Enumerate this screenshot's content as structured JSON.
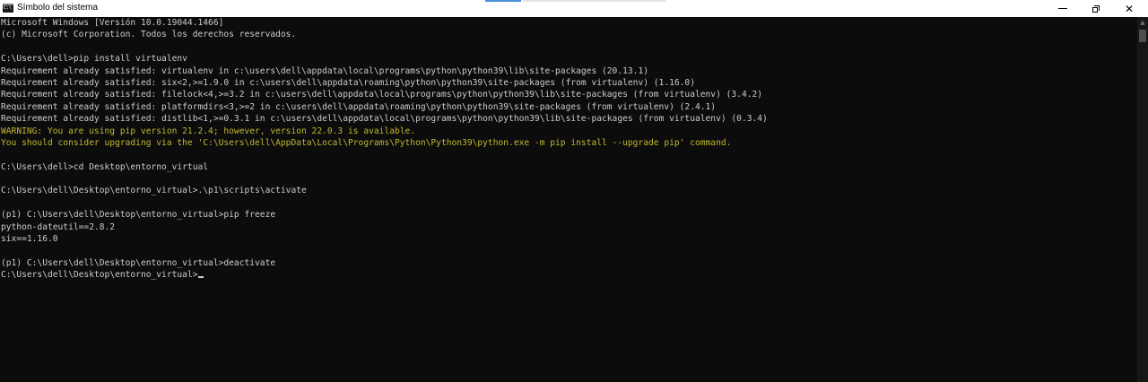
{
  "window": {
    "title": "Símbolo del sistema",
    "minimize_glyph": "",
    "close_glyph": "✕"
  },
  "console": {
    "lines": [
      {
        "text": "Microsoft Windows [Versión 10.0.19044.1466]",
        "style": "normal"
      },
      {
        "text": "(c) Microsoft Corporation. Todos los derechos reservados.",
        "style": "normal"
      },
      {
        "text": "",
        "style": "normal"
      },
      {
        "text": "C:\\Users\\dell>pip install virtualenv",
        "style": "normal"
      },
      {
        "text": "Requirement already satisfied: virtualenv in c:\\users\\dell\\appdata\\local\\programs\\python\\python39\\lib\\site-packages (20.13.1)",
        "style": "normal"
      },
      {
        "text": "Requirement already satisfied: six<2,>=1.9.0 in c:\\users\\dell\\appdata\\roaming\\python\\python39\\site-packages (from virtualenv) (1.16.0)",
        "style": "normal"
      },
      {
        "text": "Requirement already satisfied: filelock<4,>=3.2 in c:\\users\\dell\\appdata\\local\\programs\\python\\python39\\lib\\site-packages (from virtualenv) (3.4.2)",
        "style": "normal"
      },
      {
        "text": "Requirement already satisfied: platformdirs<3,>=2 in c:\\users\\dell\\appdata\\roaming\\python\\python39\\site-packages (from virtualenv) (2.4.1)",
        "style": "normal"
      },
      {
        "text": "Requirement already satisfied: distlib<1,>=0.3.1 in c:\\users\\dell\\appdata\\local\\programs\\python\\python39\\lib\\site-packages (from virtualenv) (0.3.4)",
        "style": "normal"
      },
      {
        "text": "WARNING: You are using pip version 21.2.4; however, version 22.0.3 is available.",
        "style": "warn"
      },
      {
        "text": "You should consider upgrading via the 'C:\\Users\\dell\\AppData\\Local\\Programs\\Python\\Python39\\python.exe -m pip install --upgrade pip' command.",
        "style": "warn"
      },
      {
        "text": "",
        "style": "normal"
      },
      {
        "text": "C:\\Users\\dell>cd Desktop\\entorno_virtual",
        "style": "normal"
      },
      {
        "text": "",
        "style": "normal"
      },
      {
        "text": "C:\\Users\\dell\\Desktop\\entorno_virtual>.\\p1\\scripts\\activate",
        "style": "normal"
      },
      {
        "text": "",
        "style": "normal"
      },
      {
        "text": "(p1) C:\\Users\\dell\\Desktop\\entorno_virtual>pip freeze",
        "style": "normal"
      },
      {
        "text": "python-dateutil==2.8.2",
        "style": "normal"
      },
      {
        "text": "six==1.16.0",
        "style": "normal"
      },
      {
        "text": "",
        "style": "normal"
      },
      {
        "text": "(p1) C:\\Users\\dell\\Desktop\\entorno_virtual>deactivate",
        "style": "normal"
      }
    ],
    "prompt": "C:\\Users\\dell\\Desktop\\entorno_virtual>"
  },
  "colors": {
    "background": "#0c0c0c",
    "text": "#cccccc",
    "warning": "#c1b833"
  }
}
